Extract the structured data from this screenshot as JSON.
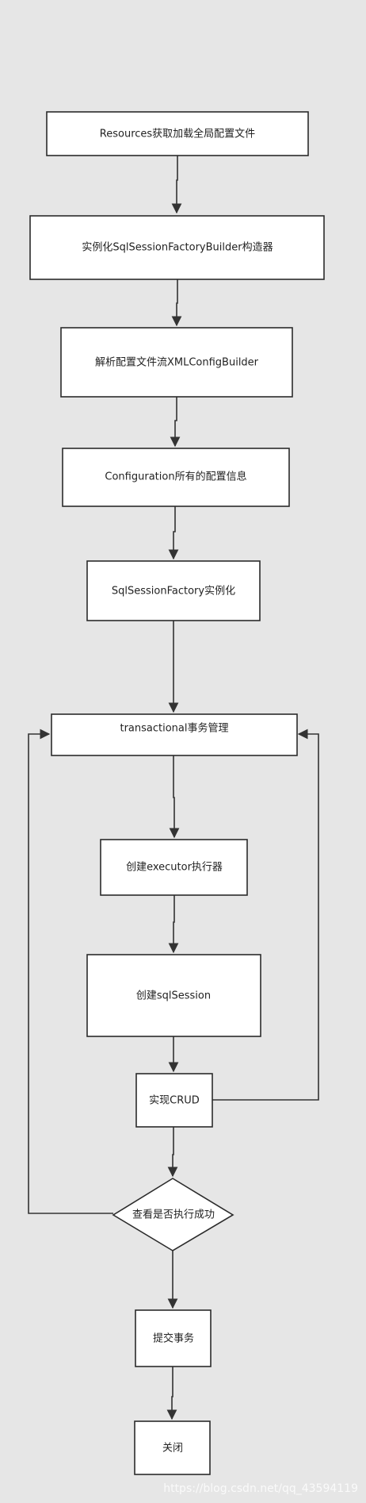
{
  "nodes": [
    {
      "id": "n1",
      "label": "Resources获取加载全局配置文件"
    },
    {
      "id": "n2",
      "label": "实例化SqlSessionFactoryBuilder构造器"
    },
    {
      "id": "n3",
      "label": "解析配置文件流XMLConfigBuilder"
    },
    {
      "id": "n4",
      "label": "Configuration所有的配置信息"
    },
    {
      "id": "n5",
      "label": "SqlSessionFactory实例化"
    },
    {
      "id": "n6",
      "label": "transactional事务管理"
    },
    {
      "id": "n7",
      "label": "创建executor执行器"
    },
    {
      "id": "n8",
      "label": "创建sqlSession"
    },
    {
      "id": "n9",
      "label": "实现CRUD"
    },
    {
      "id": "n10",
      "label": "查看是否执行成功"
    },
    {
      "id": "n11",
      "label": "提交事务"
    },
    {
      "id": "n12",
      "label": "关闭"
    }
  ],
  "edges": [
    {
      "from": "n1",
      "to": "n2"
    },
    {
      "from": "n2",
      "to": "n3"
    },
    {
      "from": "n3",
      "to": "n4"
    },
    {
      "from": "n4",
      "to": "n5"
    },
    {
      "from": "n5",
      "to": "n6"
    },
    {
      "from": "n6",
      "to": "n7"
    },
    {
      "from": "n7",
      "to": "n8"
    },
    {
      "from": "n8",
      "to": "n9"
    },
    {
      "from": "n9",
      "to": "n10"
    },
    {
      "from": "n10",
      "to": "n11"
    },
    {
      "from": "n11",
      "to": "n12"
    },
    {
      "from": "n9",
      "to": "n6"
    },
    {
      "from": "n10",
      "to": "n6"
    }
  ],
  "watermark": "https://blog.csdn.net/qq_43594119"
}
